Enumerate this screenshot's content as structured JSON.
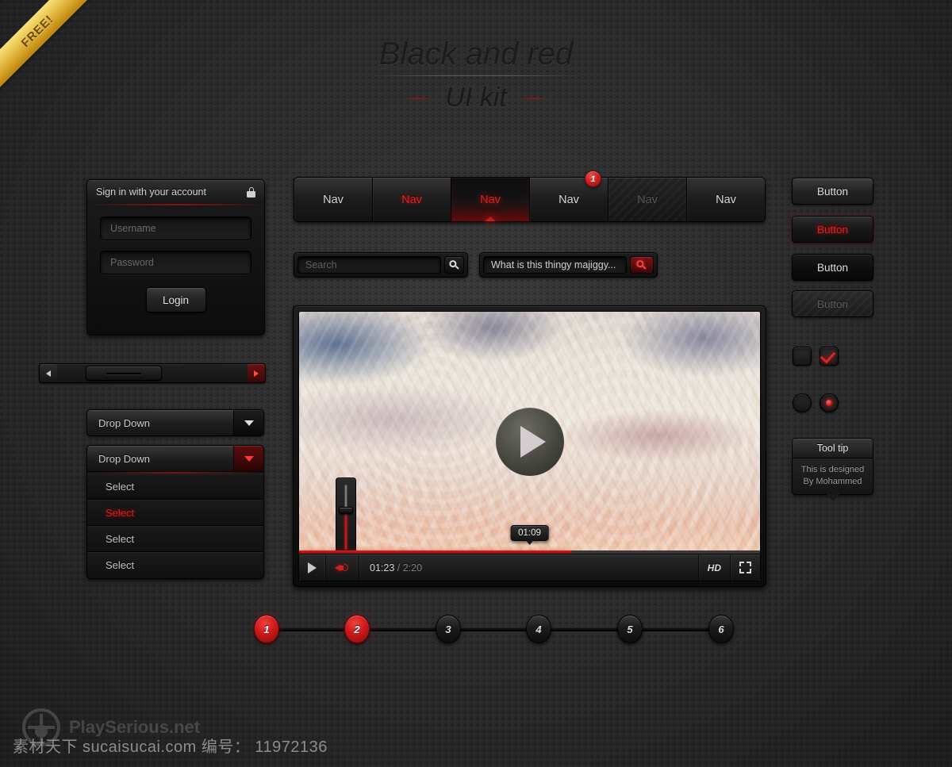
{
  "ribbon": {
    "label": "FREE!"
  },
  "title": {
    "main": "Black and red",
    "sub": "UI kit"
  },
  "login": {
    "header": "Sign in with your account",
    "lock_icon": "lock-icon",
    "username_placeholder": "Username",
    "username_value": "",
    "password_placeholder": "Password",
    "password_value": "",
    "login_button": "Login"
  },
  "scrollbar": {
    "left_arrow_icon": "chevron-left-icon",
    "right_arrow_icon": "chevron-right-icon"
  },
  "dropdowns": {
    "first": {
      "label": "Drop Down",
      "caret_icon": "chevron-down-icon"
    },
    "second": {
      "label": "Drop Down",
      "caret_icon": "chevron-down-icon"
    },
    "options": [
      {
        "label": "Select",
        "state": "normal"
      },
      {
        "label": "Select",
        "state": "active"
      },
      {
        "label": "Select",
        "state": "normal"
      },
      {
        "label": "Select",
        "state": "normal"
      }
    ]
  },
  "nav": {
    "tabs": [
      {
        "label": "Nav",
        "state": "normal"
      },
      {
        "label": "Nav",
        "state": "red"
      },
      {
        "label": "Nav",
        "state": "active"
      },
      {
        "label": "Nav",
        "state": "normal",
        "badge": "1"
      },
      {
        "label": "Nav",
        "state": "disabled"
      },
      {
        "label": "Nav",
        "state": "normal"
      }
    ]
  },
  "search": {
    "left": {
      "placeholder": "Search",
      "value": "",
      "button_icon": "search-icon"
    },
    "right": {
      "placeholder": "",
      "value": "What is this thingy majiggy...",
      "button_icon": "search-icon"
    }
  },
  "player": {
    "play_overlay_icon": "play-icon",
    "play_button_icon": "play-icon",
    "volume_icon": "speaker-icon",
    "time_current": "01:23",
    "time_separator": " / ",
    "time_total": "2:20",
    "time_tooltip": "01:09",
    "hd_label": "HD",
    "fullscreen_icon": "fullscreen-icon",
    "progress_percent": 59,
    "tooltip_position_percent": 50,
    "volume_percent": 42
  },
  "buttons": [
    {
      "label": "Button",
      "state": "normal"
    },
    {
      "label": "Button",
      "state": "red"
    },
    {
      "label": "Button",
      "state": "dark"
    },
    {
      "label": "Button",
      "state": "disabled"
    }
  ],
  "toggles": {
    "checkbox_unchecked": "checkbox-off",
    "checkbox_checked": "checkbox-on",
    "check_icon": "check-icon",
    "radio_unselected": "radio-off",
    "radio_selected": "radio-on"
  },
  "tooltip": {
    "title": "Tool tip",
    "line1": "This is designed",
    "line2": "By Mohammed"
  },
  "steps": [
    {
      "label": "1",
      "state": "on"
    },
    {
      "label": "2",
      "state": "on"
    },
    {
      "label": "3",
      "state": "off"
    },
    {
      "label": "4",
      "state": "off"
    },
    {
      "label": "5",
      "state": "off"
    },
    {
      "label": "6",
      "state": "off"
    }
  ],
  "footer": {
    "logo_text": "PlaySerious.net",
    "watermark": "素材天下 sucaisucai.com  编号： 11972136"
  },
  "colors": {
    "accent_red": "#e01f1f",
    "deep_red": "#8d1111",
    "panel_dark": "#121212",
    "background": "#2f2f2f",
    "ribbon_gold": "#e9c44e",
    "text_light": "#d8d8d8",
    "text_muted": "#6a6a6a"
  }
}
